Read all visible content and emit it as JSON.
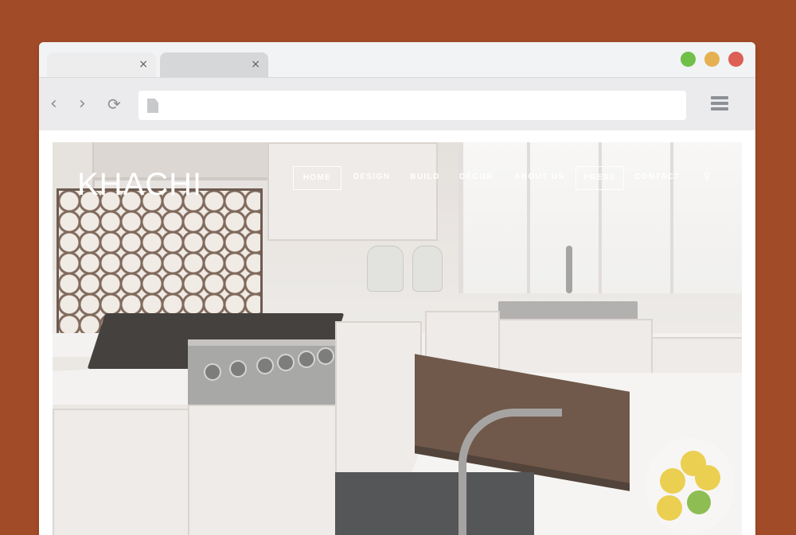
{
  "browser": {
    "tabs": [
      {
        "close_glyph": "×"
      },
      {
        "close_glyph": "×"
      }
    ],
    "window_controls": {
      "green": "#6fbf48",
      "yellow": "#e4b050",
      "red": "#dd5f55"
    },
    "toolbar": {
      "back_glyph": "‹",
      "forward_glyph": "›",
      "reload_glyph": "⟳",
      "address_value": ""
    }
  },
  "site": {
    "logo": "KHACHI",
    "nav": [
      {
        "label": "HOME"
      },
      {
        "label": "DESIGN"
      },
      {
        "label": "BUILD"
      },
      {
        "label": "DÉCOR"
      },
      {
        "label": "ABOUT US"
      },
      {
        "label": "PRESS"
      },
      {
        "label": "CONTACT"
      }
    ],
    "search_icon": "search-icon"
  },
  "colors": {
    "page_background": "#a24b28",
    "browser_chrome": "#ebebed",
    "nav_text": "#ffffff"
  }
}
